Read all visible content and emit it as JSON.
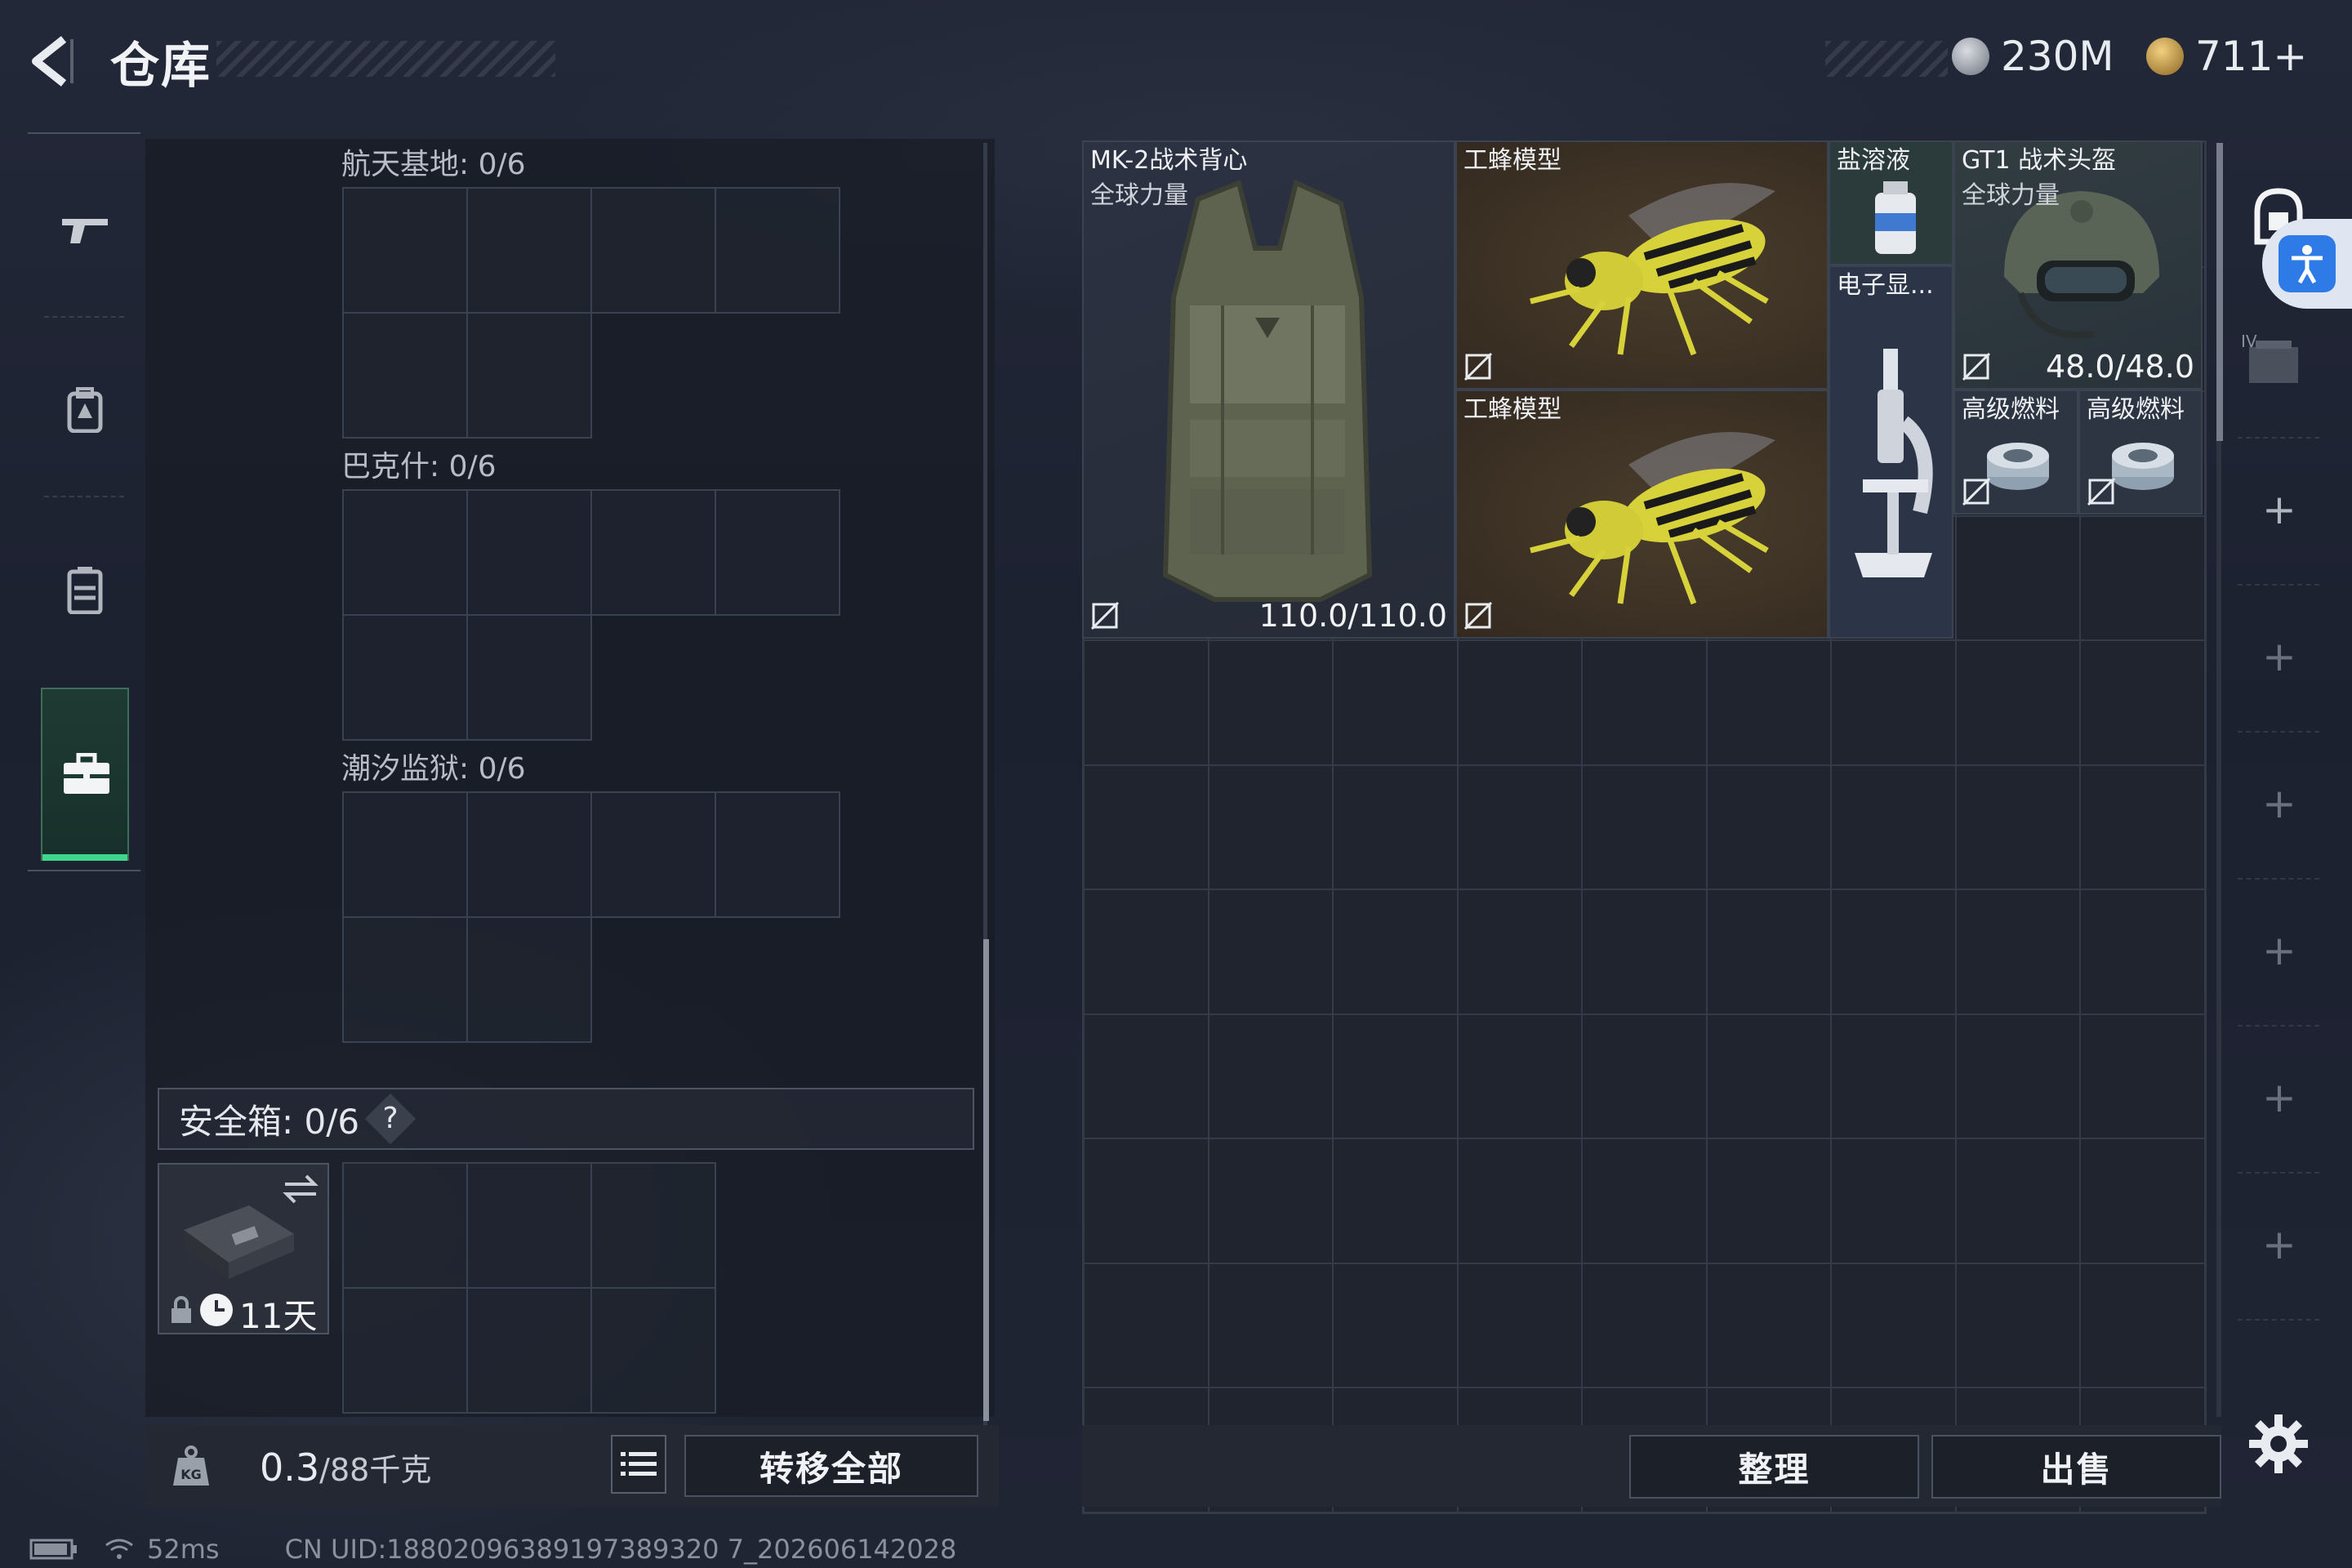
{
  "header": {
    "title": "仓库",
    "currency1_value": "230M",
    "currency2_value": "711+"
  },
  "nav": {
    "items": [
      "weapon",
      "backpack",
      "tactical-rig",
      "briefcase"
    ],
    "selected": 3
  },
  "map_slots": [
    {
      "label": "航天基地: 0/6"
    },
    {
      "label": "巴克什: 0/6"
    },
    {
      "label": "潮汐监狱: 0/6"
    }
  ],
  "safebox": {
    "label": "安全箱: 0/6",
    "help": "?",
    "duration": "11天"
  },
  "bottom": {
    "weight_current": "0.3",
    "weight_max": "/88千克",
    "transfer_all": "转移全部",
    "organize": "整理",
    "sell": "出售"
  },
  "items": [
    {
      "name": "MK-2战术背心",
      "subtitle": "全球力量",
      "durability": "110.0/110.0"
    },
    {
      "name": "工蜂模型"
    },
    {
      "name": "工蜂模型"
    },
    {
      "name": "盐溶液"
    },
    {
      "name": "电子显..."
    },
    {
      "name": "GT1 战术头盔",
      "subtitle": "全球力量",
      "durability": "48.0/48.0"
    },
    {
      "name": "高级燃料"
    },
    {
      "name": "高级燃料"
    }
  ],
  "status": {
    "ping": "52ms",
    "uid": "CN UID:18802096389197389320 7_202606142028"
  },
  "colors": {
    "accent_green": "#3fd68e",
    "bee_tile": "#3a3128",
    "vest_tile": "#2b3140",
    "helmet_tile": "#2f3a3e",
    "accessibility_blue": "#2e7be8"
  }
}
